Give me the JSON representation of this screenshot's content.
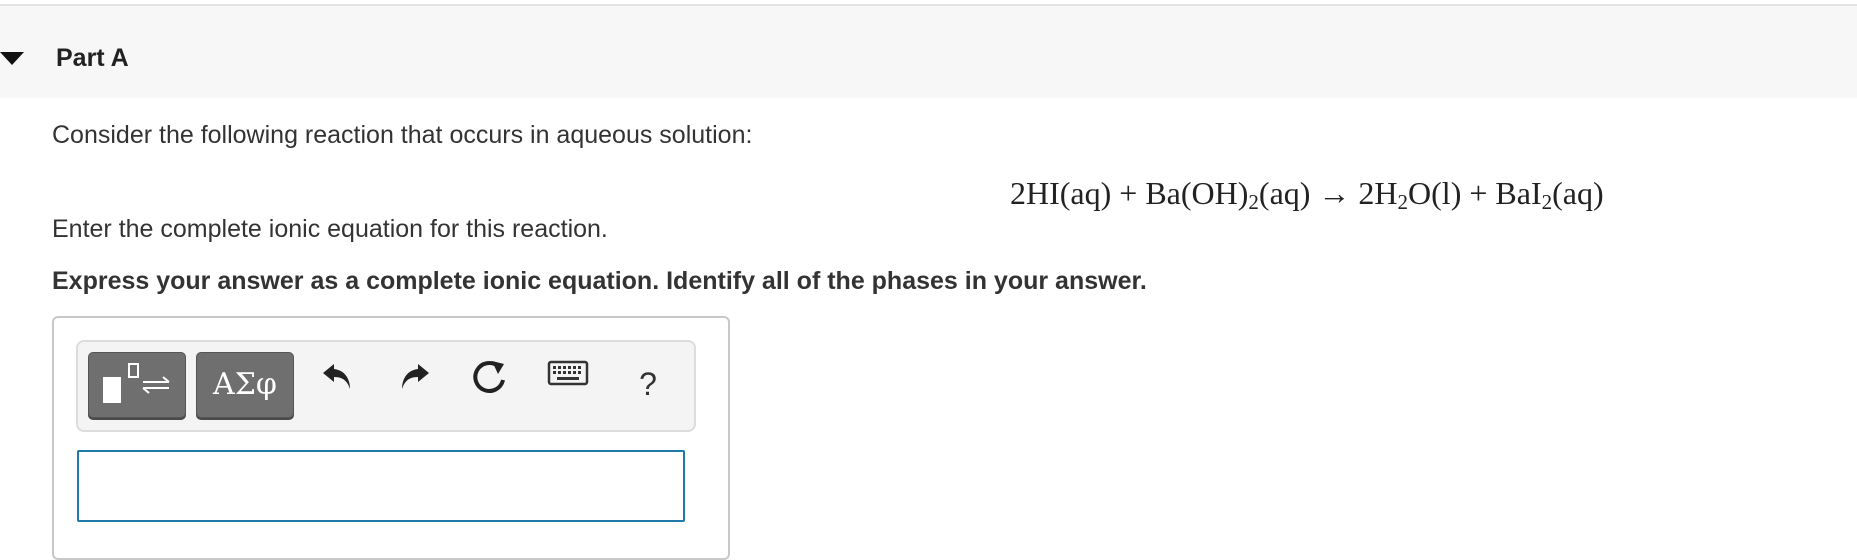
{
  "part": {
    "title": "Part A",
    "collapse_icon": "caret-down-icon"
  },
  "question": {
    "intro": "Consider the following reaction that occurs in aqueous solution:",
    "equation_parts": {
      "lhs1": "2HI(aq)",
      "plus1": "+",
      "lhs2_a": "Ba(OH)",
      "lhs2_sub": "2",
      "lhs2_b": "(aq)",
      "arrow": "→",
      "rhs1_a": "2H",
      "rhs1_sub": "2",
      "rhs1_b": "O(l)",
      "plus2": "+",
      "rhs2_a": "BaI",
      "rhs2_sub": "2",
      "rhs2_b": "(aq)"
    },
    "instruction": "Enter the complete ionic equation for this reaction.",
    "express": "Express your answer as a complete ionic equation. Identify all of the phases in your answer."
  },
  "toolbar": {
    "templates_icon": "templates-icon",
    "greek_label": "ΑΣφ",
    "undo_icon": "undo-icon",
    "redo_icon": "redo-icon",
    "reset_icon": "reset-icon",
    "keyboard_icon": "keyboard-icon",
    "help_label": "?"
  },
  "answer": {
    "value": "",
    "placeholder": ""
  },
  "colors": {
    "header_bg": "#f7f7f7",
    "button_dark": "#6f6f6f",
    "input_border": "#1f7aa8"
  }
}
